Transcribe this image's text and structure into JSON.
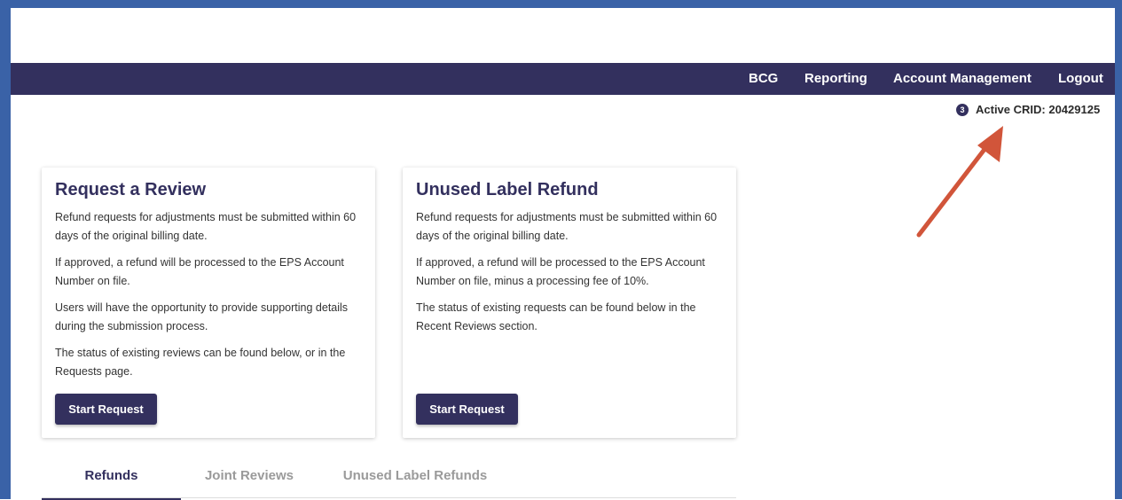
{
  "nav": {
    "items": [
      "BCG",
      "Reporting",
      "Account Management",
      "Logout"
    ]
  },
  "crid": {
    "badge": "3",
    "label": "Active CRID: 20429125"
  },
  "cards": [
    {
      "title": "Request a Review",
      "paragraphs": [
        "Refund requests for adjustments must be submitted within 60 days of the original billing date.",
        "If approved, a refund will be processed to the EPS Account Number on file.",
        "Users will have the opportunity to provide supporting details during the submission process.",
        "The status of existing reviews can be found below, or in the Requests page."
      ],
      "button": "Start Request"
    },
    {
      "title": "Unused Label Refund",
      "paragraphs": [
        "Refund requests for adjustments must be submitted within 60 days of the original billing date.",
        "If approved, a refund will be processed to the EPS Account Number on file, minus a processing fee of 10%.",
        "The status of existing requests can be found below in the Recent Reviews section."
      ],
      "button": "Start Request"
    }
  ],
  "tabs": [
    {
      "label": "Refunds",
      "active": true
    },
    {
      "label": "Joint Reviews",
      "active": false
    },
    {
      "label": "Unused Label Refunds",
      "active": false
    }
  ],
  "colors": {
    "brand": "#33305e",
    "frame": "#3a62a7",
    "annotation_arrow": "#d1553a"
  }
}
